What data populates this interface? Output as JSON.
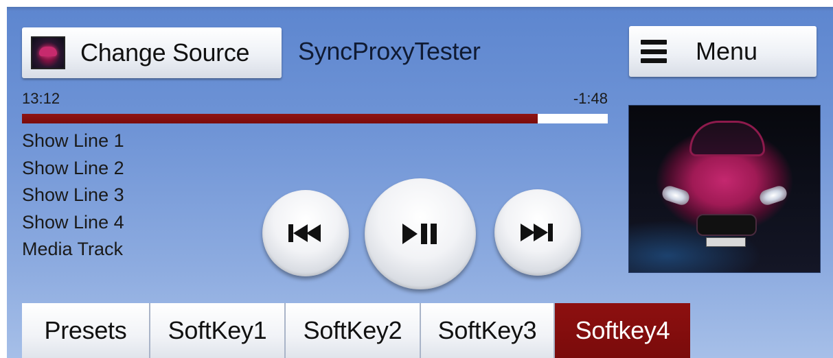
{
  "header": {
    "change_source_label": "Change Source",
    "app_title": "SyncProxyTester",
    "menu_label": "Menu"
  },
  "playback": {
    "elapsed": "13:12",
    "remaining": "-1:48",
    "progress_fraction": 0.88
  },
  "display_lines": [
    "Show Line 1",
    "Show Line 2",
    "Show Line 3",
    "Show Line 4",
    "Media Track"
  ],
  "softkeys": [
    {
      "label": "Presets",
      "active": false
    },
    {
      "label": "SoftKey1",
      "active": false
    },
    {
      "label": "SoftKey2",
      "active": false
    },
    {
      "label": "SoftKey3",
      "active": false
    },
    {
      "label": "Softkey4",
      "active": true
    }
  ],
  "icons": {
    "source_thumbnail": "car-thumbnail-icon",
    "menu": "hamburger-menu-icon",
    "previous": "skip-previous-icon",
    "play_pause": "play-pause-icon",
    "next": "skip-next-icon",
    "album_art": "album-art-car-image"
  },
  "colors": {
    "background_top": "#5d86cf",
    "background_bottom": "#a6bfe8",
    "progress_fill": "#8f1414",
    "progress_track": "#ffffff",
    "active_softkey": "#8d1010"
  }
}
